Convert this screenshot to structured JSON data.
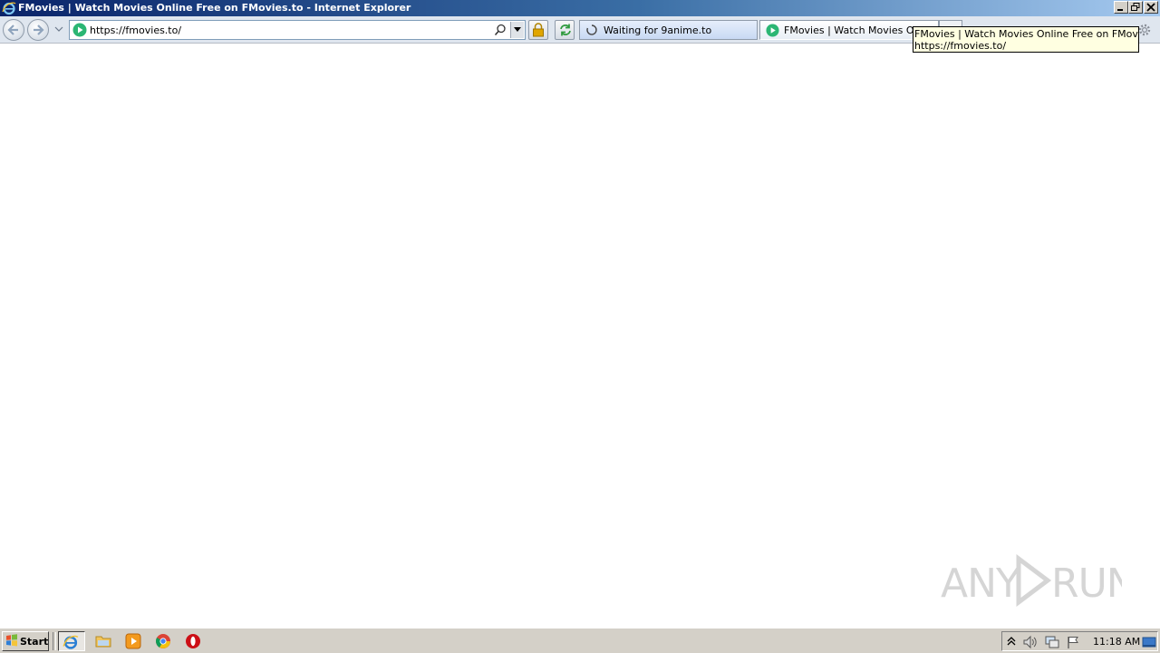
{
  "window": {
    "title": "FMovies | Watch Movies Online Free on FMovies.to - Internet Explorer"
  },
  "navbar": {
    "url": "https://fmovies.to/",
    "tabs": [
      {
        "label": "Waiting for 9anime.to",
        "state": "loading"
      },
      {
        "label": "FMovies | Watch Movies Onli...",
        "state": "active"
      }
    ]
  },
  "tooltip": {
    "line1": "FMovies | Watch Movies Online Free on FMovies.to",
    "line2": "https://fmovies.to/"
  },
  "watermark": {
    "text": "ANY RUN"
  },
  "taskbar": {
    "start_label": "Start",
    "clock": "11:18 AM"
  },
  "colors": {
    "titlebar_start": "#0a246a",
    "titlebar_end": "#a6caf0",
    "site_icon": "#2bb673",
    "lock": "#e0a500"
  }
}
